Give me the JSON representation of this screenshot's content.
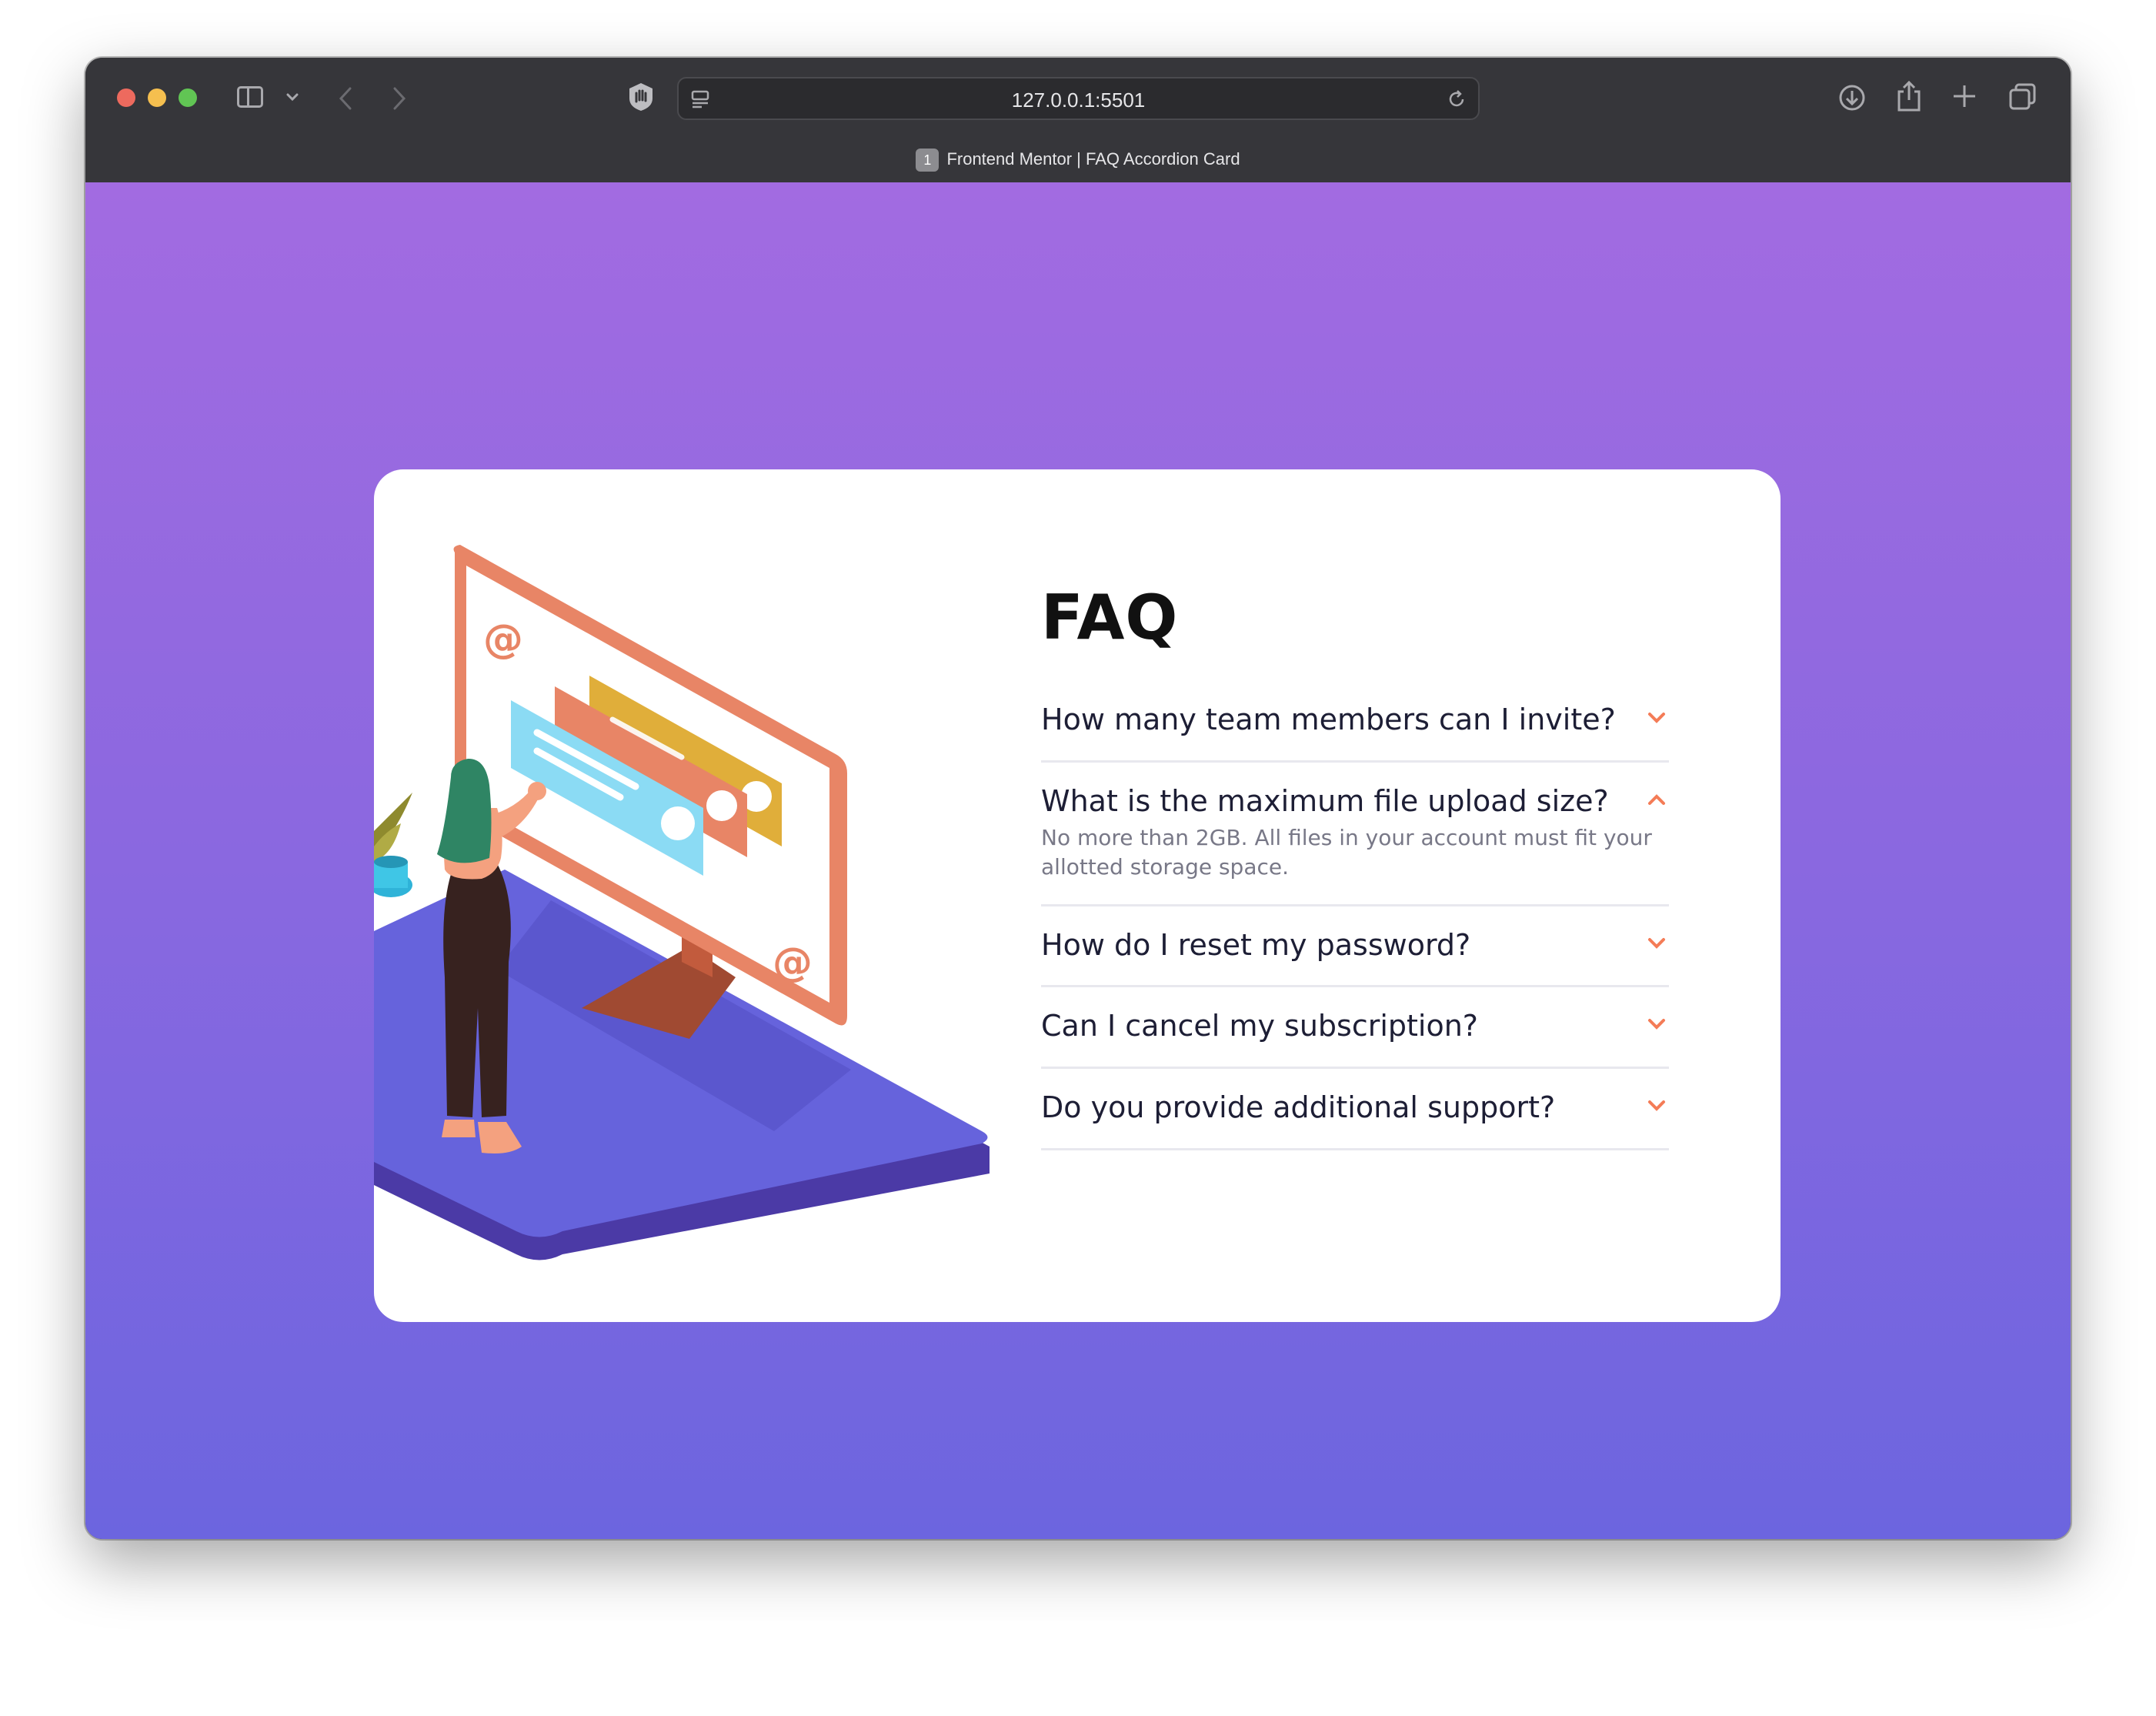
{
  "browser": {
    "url": "127.0.0.1:5501",
    "tab_number": "1",
    "tab_title": "Frontend Mentor | FAQ Accordion Card"
  },
  "colors": {
    "accent": "#f47c57",
    "question": "#1d1e35",
    "answer": "#787887",
    "gradient_top": "#a26be1",
    "gradient_bottom": "#6c65df"
  },
  "faq": {
    "title": "FAQ",
    "items": [
      {
        "question": "How many team members can I invite?",
        "expanded": false,
        "icon": "chevron-down-icon"
      },
      {
        "question": "What is the maximum file upload size?",
        "expanded": true,
        "icon": "chevron-up-icon",
        "answer": "No more than 2GB. All files in your account must fit your allotted storage space."
      },
      {
        "question": "How do I reset my password?",
        "expanded": false,
        "icon": "chevron-down-icon"
      },
      {
        "question": "Can I cancel my subscription?",
        "expanded": false,
        "icon": "chevron-down-icon"
      },
      {
        "question": "Do you provide additional support?",
        "expanded": false,
        "icon": "chevron-down-icon"
      }
    ]
  }
}
